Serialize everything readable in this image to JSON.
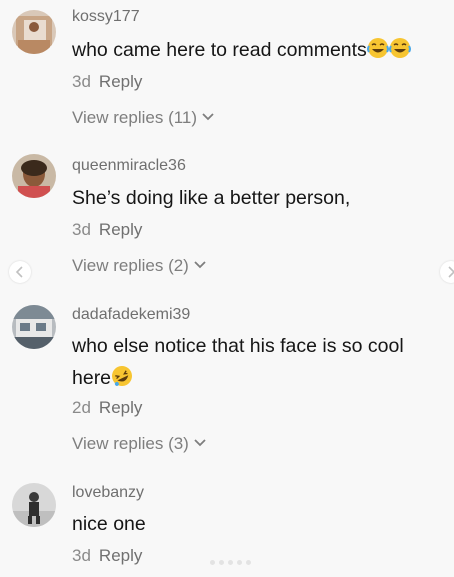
{
  "comments": [
    {
      "username": "kossy177",
      "text": "who came here to read comments",
      "emojis": [
        "laughing-tears-emoji",
        "laughing-tears-emoji"
      ],
      "time": "3d",
      "reply": "Reply",
      "view_replies": "View replies (11)"
    },
    {
      "username": "queenmiracle36",
      "text": "She’s doing like a better person,",
      "time": "3d",
      "reply": "Reply",
      "view_replies": "View replies (2)"
    },
    {
      "username": "dadafadekemi39",
      "text_line1": "who else notice that his face is so cool",
      "text_line2": "here",
      "emojis": [
        "rolling-laughing-emoji"
      ],
      "time": "2d",
      "reply": "Reply",
      "view_replies": "View replies (3)"
    },
    {
      "username": "lovebanzy",
      "text": "nice one",
      "time": "3d",
      "reply": "Reply"
    }
  ],
  "colors": {
    "background": "#f8f8f8",
    "username": "#6f6f6f",
    "comment_text": "#161616",
    "meta": "#8a8a8a"
  },
  "icons": {
    "prev": "chevron-left-icon",
    "next": "chevron-right-icon",
    "expand": "chevron-down-icon"
  }
}
